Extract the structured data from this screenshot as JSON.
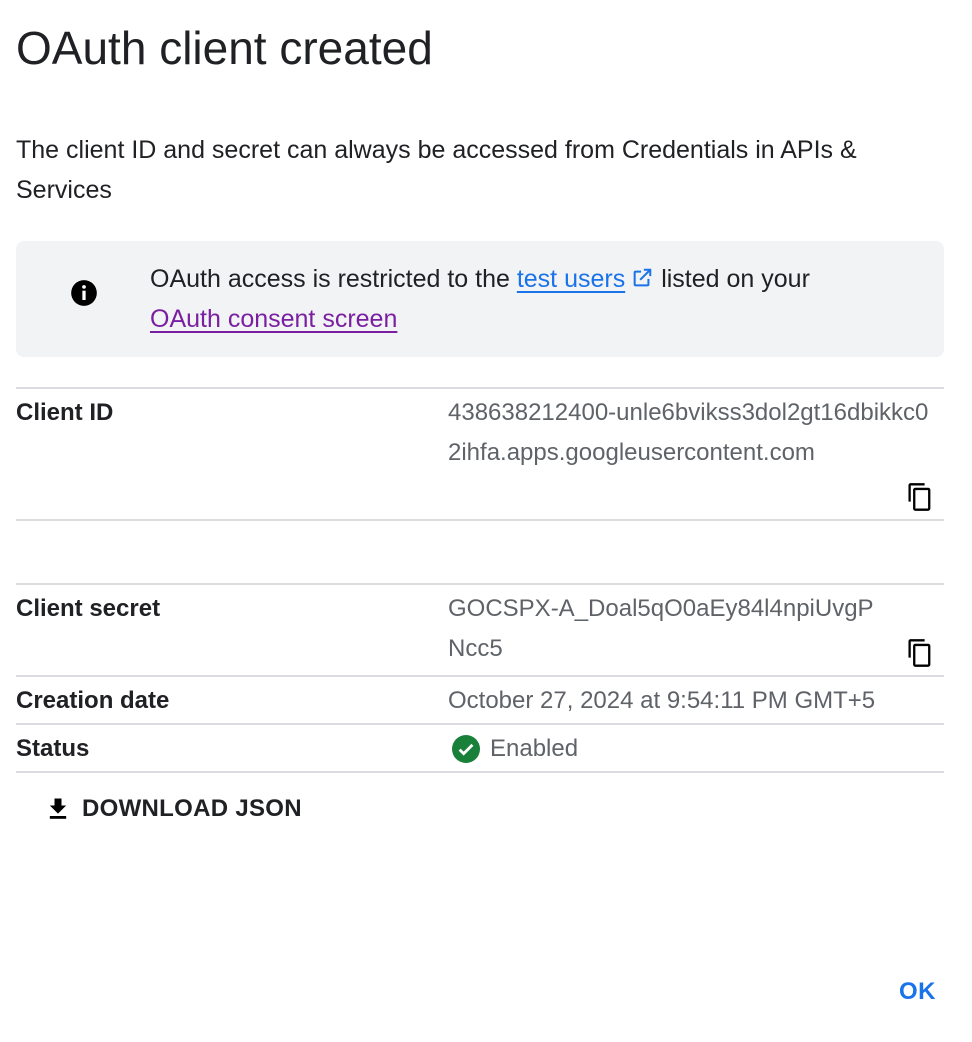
{
  "dialog": {
    "title": "OAuth client created",
    "description": "The client ID and secret can always be accessed from Credentials in APIs & Services"
  },
  "banner": {
    "icon": "info-icon",
    "text_before": "OAuth access is restricted to the ",
    "link_test_users": "test users",
    "link_test_users_icon": "external-link-icon",
    "text_after": "listed on your",
    "link_consent_screen": "OAuth consent screen"
  },
  "details": {
    "client_id_label": "Client ID",
    "client_id_value": "438638212400-unle6bvikss3dol2gt16dbikkc02ihfa.apps.googleusercontent.com",
    "client_secret_label": "Client secret",
    "client_secret_value": "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",
    "creation_date_label": "Creation date",
    "creation_date_value": "October 27, 2024 at 9:54:11 PM GMT+5",
    "status_label": "Status",
    "status_value": "Enabled",
    "copy_icon": "copy-icon",
    "status_icon": "check-circle-icon"
  },
  "actions": {
    "download_label": "DOWNLOAD JSON",
    "download_icon": "download-icon",
    "ok_label": "OK"
  },
  "colors": {
    "link_blue": "#1a73e8",
    "link_visited": "#7b1fa2",
    "status_green": "#188038",
    "banner_bg": "#f1f3f4",
    "divider": "#dadce0"
  }
}
